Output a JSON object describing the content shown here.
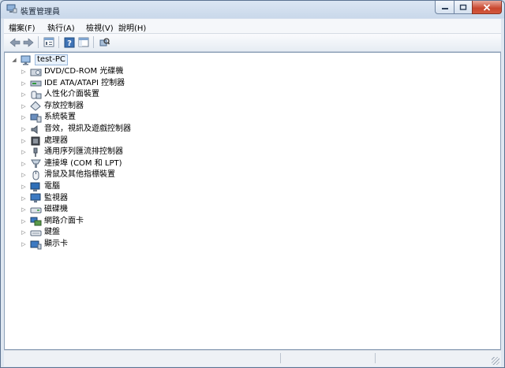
{
  "window": {
    "title": "裝置管理員"
  },
  "menu": [
    {
      "label": "檔案(F)"
    },
    {
      "label": "執行(A)"
    },
    {
      "label": "檢視(V)"
    },
    {
      "label": "說明(H)"
    }
  ],
  "toolbar": {
    "icons": [
      "back-arrow-icon",
      "forward-arrow-icon",
      "properties-icon",
      "help-icon",
      "console-tree-icon",
      "scan-hardware-icon"
    ]
  },
  "tree": {
    "root": "test-PC",
    "items": [
      {
        "label": "DVD/CD-ROM 光碟機",
        "icon": "dvd-drive-icon"
      },
      {
        "label": "IDE ATA/ATAPI 控制器",
        "icon": "ide-controller-icon"
      },
      {
        "label": "人性化介面裝置",
        "icon": "hid-icon"
      },
      {
        "label": "存放控制器",
        "icon": "storage-controller-icon"
      },
      {
        "label": "系統裝置",
        "icon": "system-devices-icon"
      },
      {
        "label": "音效，視訊及遊戲控制器",
        "icon": "sound-icon"
      },
      {
        "label": "處理器",
        "icon": "processor-icon"
      },
      {
        "label": "通用序列匯流排控制器",
        "icon": "usb-controller-icon"
      },
      {
        "label": "連接埠 (COM 和 LPT)",
        "icon": "ports-icon"
      },
      {
        "label": "滑鼠及其他指標裝置",
        "icon": "mouse-icon"
      },
      {
        "label": "電腦",
        "icon": "computer-icon"
      },
      {
        "label": "監視器",
        "icon": "monitor-icon"
      },
      {
        "label": "磁碟機",
        "icon": "disk-drive-icon"
      },
      {
        "label": "網路介面卡",
        "icon": "network-adapter-icon"
      },
      {
        "label": "鍵盤",
        "icon": "keyboard-icon"
      },
      {
        "label": "顯示卡",
        "icon": "display-adapter-icon"
      }
    ]
  },
  "colors": {
    "accent": "#1c5ea8",
    "close": "#c8462e"
  }
}
